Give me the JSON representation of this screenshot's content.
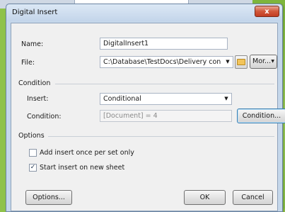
{
  "window": {
    "title": "Digital Insert",
    "close_label": "x"
  },
  "name": {
    "label": "Name:",
    "value": "DigitalInsert1"
  },
  "file": {
    "label": "File:",
    "value": "C:\\Database\\TestDocs\\Delivery con",
    "more_label": "Mor..."
  },
  "condition_group": {
    "title": "Condition",
    "insert_label": "Insert:",
    "insert_value": "Conditional",
    "condition_label": "Condition:",
    "condition_value": "[Document] = 4",
    "condition_button": "Condition..."
  },
  "options_group": {
    "title": "Options",
    "add_once_label": "Add insert once per set only",
    "add_once_checked": false,
    "start_new_sheet_label": "Start insert on new sheet",
    "start_new_sheet_checked": true
  },
  "buttons": {
    "options": "Options...",
    "ok": "OK",
    "cancel": "Cancel"
  },
  "icons": {
    "dropdown": "chevron-down-icon",
    "folder": "folder-icon",
    "close": "close-icon",
    "check": "checkmark-icon"
  }
}
